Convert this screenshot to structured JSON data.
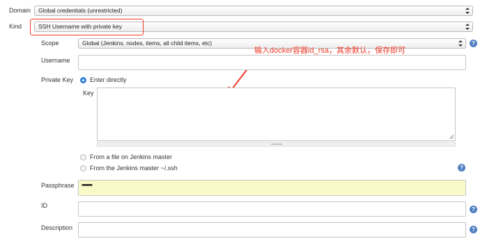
{
  "domain": {
    "label": "Domain",
    "value": "Global credentials (unrestricted)"
  },
  "kind": {
    "label": "Kind",
    "value": "SSH Username with private key"
  },
  "scope": {
    "label": "Scope",
    "value": "Global (Jenkins, nodes, items, all child items, etc)"
  },
  "username": {
    "label": "Username",
    "value": ""
  },
  "private_key": {
    "label": "Private Key",
    "options": [
      {
        "label": "Enter directly",
        "selected": true
      },
      {
        "label": "From a file on Jenkins master",
        "selected": false
      },
      {
        "label": "From the Jenkins master ~/.ssh",
        "selected": false
      }
    ],
    "key_label": "Key",
    "key_value": ""
  },
  "passphrase": {
    "label": "Passphrase",
    "masked_value": "••••••••••••••••••••••••••••••••••"
  },
  "id_field": {
    "label": "ID",
    "value": ""
  },
  "description": {
    "label": "Description",
    "value": ""
  },
  "help_icon_text": "?",
  "annotation": {
    "text": "输入docker容器id_rsa，其余默认，保存即可",
    "color": "#f03a28"
  },
  "colors": {
    "radio_selected": "#2f7de0",
    "help_icon": "#4f7ec2",
    "passphrase_bg": "#fafac8",
    "highlight_border": "#f03a28"
  }
}
